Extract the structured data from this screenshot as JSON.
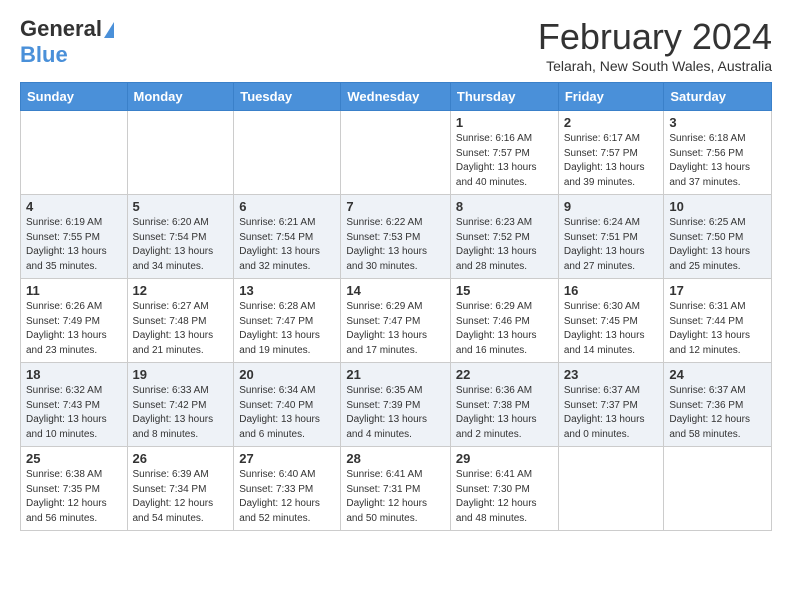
{
  "logo": {
    "general": "General",
    "blue": "Blue"
  },
  "header": {
    "month_year": "February 2024",
    "location": "Telarah, New South Wales, Australia"
  },
  "weekdays": [
    "Sunday",
    "Monday",
    "Tuesday",
    "Wednesday",
    "Thursday",
    "Friday",
    "Saturday"
  ],
  "weeks": [
    [
      {
        "day": "",
        "info": ""
      },
      {
        "day": "",
        "info": ""
      },
      {
        "day": "",
        "info": ""
      },
      {
        "day": "",
        "info": ""
      },
      {
        "day": "1",
        "info": "Sunrise: 6:16 AM\nSunset: 7:57 PM\nDaylight: 13 hours\nand 40 minutes."
      },
      {
        "day": "2",
        "info": "Sunrise: 6:17 AM\nSunset: 7:57 PM\nDaylight: 13 hours\nand 39 minutes."
      },
      {
        "day": "3",
        "info": "Sunrise: 6:18 AM\nSunset: 7:56 PM\nDaylight: 13 hours\nand 37 minutes."
      }
    ],
    [
      {
        "day": "4",
        "info": "Sunrise: 6:19 AM\nSunset: 7:55 PM\nDaylight: 13 hours\nand 35 minutes."
      },
      {
        "day": "5",
        "info": "Sunrise: 6:20 AM\nSunset: 7:54 PM\nDaylight: 13 hours\nand 34 minutes."
      },
      {
        "day": "6",
        "info": "Sunrise: 6:21 AM\nSunset: 7:54 PM\nDaylight: 13 hours\nand 32 minutes."
      },
      {
        "day": "7",
        "info": "Sunrise: 6:22 AM\nSunset: 7:53 PM\nDaylight: 13 hours\nand 30 minutes."
      },
      {
        "day": "8",
        "info": "Sunrise: 6:23 AM\nSunset: 7:52 PM\nDaylight: 13 hours\nand 28 minutes."
      },
      {
        "day": "9",
        "info": "Sunrise: 6:24 AM\nSunset: 7:51 PM\nDaylight: 13 hours\nand 27 minutes."
      },
      {
        "day": "10",
        "info": "Sunrise: 6:25 AM\nSunset: 7:50 PM\nDaylight: 13 hours\nand 25 minutes."
      }
    ],
    [
      {
        "day": "11",
        "info": "Sunrise: 6:26 AM\nSunset: 7:49 PM\nDaylight: 13 hours\nand 23 minutes."
      },
      {
        "day": "12",
        "info": "Sunrise: 6:27 AM\nSunset: 7:48 PM\nDaylight: 13 hours\nand 21 minutes."
      },
      {
        "day": "13",
        "info": "Sunrise: 6:28 AM\nSunset: 7:47 PM\nDaylight: 13 hours\nand 19 minutes."
      },
      {
        "day": "14",
        "info": "Sunrise: 6:29 AM\nSunset: 7:47 PM\nDaylight: 13 hours\nand 17 minutes."
      },
      {
        "day": "15",
        "info": "Sunrise: 6:29 AM\nSunset: 7:46 PM\nDaylight: 13 hours\nand 16 minutes."
      },
      {
        "day": "16",
        "info": "Sunrise: 6:30 AM\nSunset: 7:45 PM\nDaylight: 13 hours\nand 14 minutes."
      },
      {
        "day": "17",
        "info": "Sunrise: 6:31 AM\nSunset: 7:44 PM\nDaylight: 13 hours\nand 12 minutes."
      }
    ],
    [
      {
        "day": "18",
        "info": "Sunrise: 6:32 AM\nSunset: 7:43 PM\nDaylight: 13 hours\nand 10 minutes."
      },
      {
        "day": "19",
        "info": "Sunrise: 6:33 AM\nSunset: 7:42 PM\nDaylight: 13 hours\nand 8 minutes."
      },
      {
        "day": "20",
        "info": "Sunrise: 6:34 AM\nSunset: 7:40 PM\nDaylight: 13 hours\nand 6 minutes."
      },
      {
        "day": "21",
        "info": "Sunrise: 6:35 AM\nSunset: 7:39 PM\nDaylight: 13 hours\nand 4 minutes."
      },
      {
        "day": "22",
        "info": "Sunrise: 6:36 AM\nSunset: 7:38 PM\nDaylight: 13 hours\nand 2 minutes."
      },
      {
        "day": "23",
        "info": "Sunrise: 6:37 AM\nSunset: 7:37 PM\nDaylight: 13 hours\nand 0 minutes."
      },
      {
        "day": "24",
        "info": "Sunrise: 6:37 AM\nSunset: 7:36 PM\nDaylight: 12 hours\nand 58 minutes."
      }
    ],
    [
      {
        "day": "25",
        "info": "Sunrise: 6:38 AM\nSunset: 7:35 PM\nDaylight: 12 hours\nand 56 minutes."
      },
      {
        "day": "26",
        "info": "Sunrise: 6:39 AM\nSunset: 7:34 PM\nDaylight: 12 hours\nand 54 minutes."
      },
      {
        "day": "27",
        "info": "Sunrise: 6:40 AM\nSunset: 7:33 PM\nDaylight: 12 hours\nand 52 minutes."
      },
      {
        "day": "28",
        "info": "Sunrise: 6:41 AM\nSunset: 7:31 PM\nDaylight: 12 hours\nand 50 minutes."
      },
      {
        "day": "29",
        "info": "Sunrise: 6:41 AM\nSunset: 7:30 PM\nDaylight: 12 hours\nand 48 minutes."
      },
      {
        "day": "",
        "info": ""
      },
      {
        "day": "",
        "info": ""
      }
    ]
  ]
}
